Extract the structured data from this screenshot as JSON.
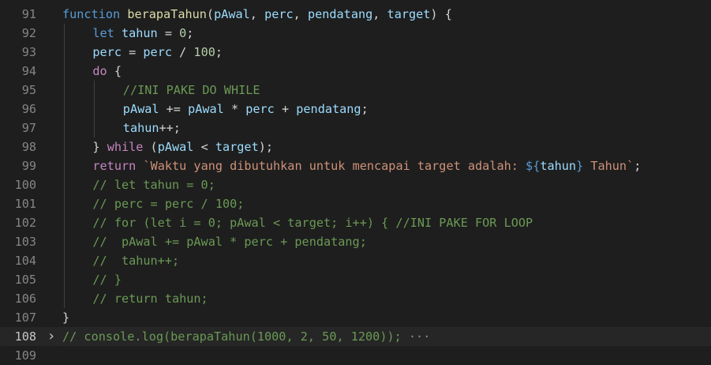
{
  "editor": {
    "lines": [
      {
        "num": "91",
        "indent": 0,
        "tokens": [
          {
            "t": "function",
            "c": "kw"
          },
          {
            "t": " ",
            "c": "pun"
          },
          {
            "t": "berapaTahun",
            "c": "fn"
          },
          {
            "t": "(",
            "c": "pun"
          },
          {
            "t": "pAwal",
            "c": "var"
          },
          {
            "t": ", ",
            "c": "pun"
          },
          {
            "t": "perc",
            "c": "var"
          },
          {
            "t": ", ",
            "c": "pun"
          },
          {
            "t": "pendatang",
            "c": "var"
          },
          {
            "t": ", ",
            "c": "pun"
          },
          {
            "t": "target",
            "c": "var"
          },
          {
            "t": ") {",
            "c": "pun"
          }
        ]
      },
      {
        "num": "92",
        "indent": 1,
        "tokens": [
          {
            "t": "let",
            "c": "kw"
          },
          {
            "t": " ",
            "c": "pun"
          },
          {
            "t": "tahun",
            "c": "var"
          },
          {
            "t": " = ",
            "c": "pun"
          },
          {
            "t": "0",
            "c": "num"
          },
          {
            "t": ";",
            "c": "pun"
          }
        ]
      },
      {
        "num": "93",
        "indent": 1,
        "tokens": [
          {
            "t": "perc",
            "c": "var"
          },
          {
            "t": " = ",
            "c": "pun"
          },
          {
            "t": "perc",
            "c": "var"
          },
          {
            "t": " / ",
            "c": "pun"
          },
          {
            "t": "100",
            "c": "num"
          },
          {
            "t": ";",
            "c": "pun"
          }
        ]
      },
      {
        "num": "94",
        "indent": 1,
        "tokens": [
          {
            "t": "do",
            "c": "ctl"
          },
          {
            "t": " {",
            "c": "pun"
          }
        ]
      },
      {
        "num": "95",
        "indent": 2,
        "tokens": [
          {
            "t": "//INI PAKE DO WHILE",
            "c": "cmt"
          }
        ]
      },
      {
        "num": "96",
        "indent": 2,
        "tokens": [
          {
            "t": "pAwal",
            "c": "var"
          },
          {
            "t": " += ",
            "c": "pun"
          },
          {
            "t": "pAwal",
            "c": "var"
          },
          {
            "t": " * ",
            "c": "pun"
          },
          {
            "t": "perc",
            "c": "var"
          },
          {
            "t": " + ",
            "c": "pun"
          },
          {
            "t": "pendatang",
            "c": "var"
          },
          {
            "t": ";",
            "c": "pun"
          }
        ]
      },
      {
        "num": "97",
        "indent": 2,
        "tokens": [
          {
            "t": "tahun",
            "c": "var"
          },
          {
            "t": "++;",
            "c": "pun"
          }
        ]
      },
      {
        "num": "98",
        "indent": 1,
        "tokens": [
          {
            "t": "} ",
            "c": "pun"
          },
          {
            "t": "while",
            "c": "ctl"
          },
          {
            "t": " (",
            "c": "pun"
          },
          {
            "t": "pAwal",
            "c": "var"
          },
          {
            "t": " < ",
            "c": "pun"
          },
          {
            "t": "target",
            "c": "var"
          },
          {
            "t": ");",
            "c": "pun"
          }
        ]
      },
      {
        "num": "99",
        "indent": 1,
        "tokens": [
          {
            "t": "return",
            "c": "ctl"
          },
          {
            "t": " ",
            "c": "pun"
          },
          {
            "t": "`Waktu yang dibutuhkan untuk mencapai target adalah: ",
            "c": "str"
          },
          {
            "t": "${",
            "c": "kw"
          },
          {
            "t": "tahun",
            "c": "var"
          },
          {
            "t": "}",
            "c": "kw"
          },
          {
            "t": " Tahun`",
            "c": "str"
          },
          {
            "t": ";",
            "c": "pun"
          }
        ]
      },
      {
        "num": "100",
        "indent": 1,
        "tokens": [
          {
            "t": "// let tahun = 0;",
            "c": "cmt"
          }
        ]
      },
      {
        "num": "101",
        "indent": 1,
        "tokens": [
          {
            "t": "// perc = perc / 100;",
            "c": "cmt"
          }
        ]
      },
      {
        "num": "102",
        "indent": 1,
        "tokens": [
          {
            "t": "// for (let i = 0; pAwal < target; i++) { //INI PAKE FOR LOOP",
            "c": "cmt"
          }
        ]
      },
      {
        "num": "103",
        "indent": 1,
        "tokens": [
          {
            "t": "//  pAwal += pAwal * perc + pendatang;",
            "c": "cmt"
          }
        ]
      },
      {
        "num": "104",
        "indent": 1,
        "tokens": [
          {
            "t": "//  tahun++;",
            "c": "cmt"
          }
        ]
      },
      {
        "num": "105",
        "indent": 1,
        "tokens": [
          {
            "t": "// }",
            "c": "cmt"
          }
        ]
      },
      {
        "num": "106",
        "indent": 1,
        "tokens": [
          {
            "t": "// return tahun;",
            "c": "cmt"
          }
        ]
      },
      {
        "num": "107",
        "indent": 0,
        "tokens": [
          {
            "t": "}",
            "c": "pun"
          }
        ]
      },
      {
        "num": "108",
        "indent": 0,
        "current": true,
        "folded": true,
        "tokens": [
          {
            "t": "// console.log(berapaTahun(1000, 2, 50, 1200));",
            "c": "cmt"
          },
          {
            "t": " ···",
            "c": "ell"
          }
        ]
      }
    ],
    "partial_line": {
      "num": "109"
    },
    "fold_icon": "chevron-right-icon",
    "colors": {
      "background": "#1e1e1e",
      "keyword": "#569cd6",
      "control": "#c586c0",
      "function": "#dcdcaa",
      "variable": "#9cdcfe",
      "number": "#b5cea8",
      "comment": "#6a9955",
      "string": "#ce9178"
    }
  }
}
